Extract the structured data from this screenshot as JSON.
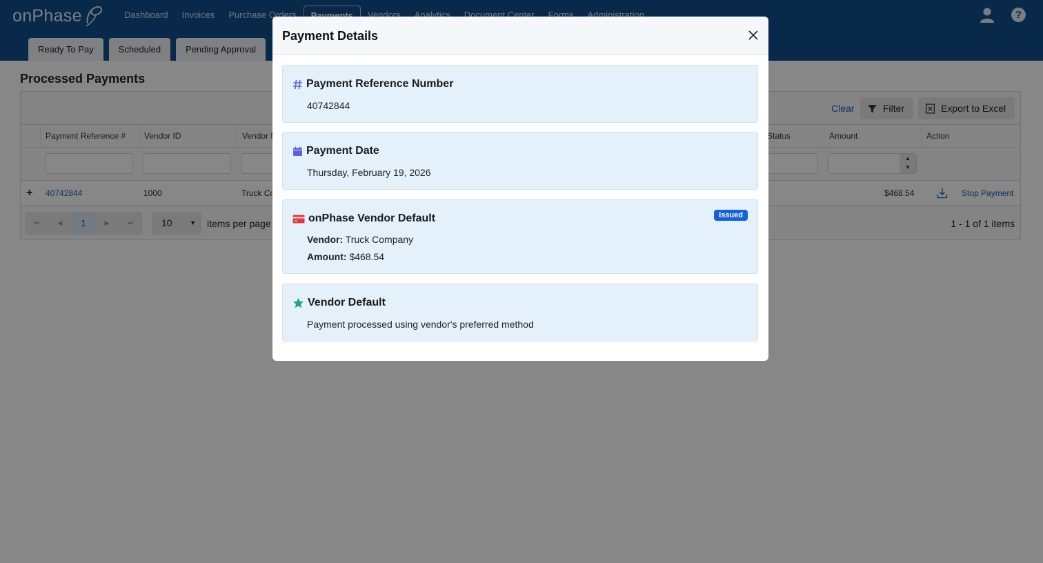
{
  "app": {
    "logo": "onPhase"
  },
  "nav": [
    {
      "label": "Dashboard"
    },
    {
      "label": "Invoices"
    },
    {
      "label": "Purchase Orders"
    },
    {
      "label": "Payments"
    },
    {
      "label": "Vendors"
    },
    {
      "label": "Analytics"
    },
    {
      "label": "Document Center"
    },
    {
      "label": "Forms"
    },
    {
      "label": "Administration"
    }
  ],
  "help": {
    "glyph": "?"
  },
  "subtabs": [
    {
      "label": "Ready To Pay"
    },
    {
      "label": "Scheduled"
    },
    {
      "label": "Pending Approval"
    }
  ],
  "page": {
    "title": "Processed Payments"
  },
  "toolbar": {
    "clear": "Clear",
    "filter": "Filter",
    "export": "Export to Excel"
  },
  "grid": {
    "columns": [
      "Payment Reference #",
      "Vendor ID",
      "Vendor N",
      "Status",
      "Amount",
      "Action"
    ],
    "row": {
      "expand": "+",
      "ref": "40742844",
      "vendor_id": "1000",
      "vendor_name": "Truck Co",
      "amount": "$468.54",
      "action": "Stop Payment"
    }
  },
  "pager": {
    "current": "1",
    "first": "⏮",
    "prev": "◀",
    "next": "▶",
    "last": "⏭",
    "size": "10",
    "caret": "▼",
    "label": "items per page",
    "info": "1 - 1 of 1 items"
  },
  "modal": {
    "title": "Payment Details",
    "reference": {
      "title": "Payment Reference Number",
      "value": "40742844"
    },
    "date": {
      "title": "Payment Date",
      "value": "Thursday, February 19, 2026"
    },
    "method": {
      "title": "onPhase Vendor Default",
      "badge": "Issued",
      "vendor_label": "Vendor:",
      "vendor_value": "Truck Company",
      "amount_label": "Amount:",
      "amount_value": "$468.54"
    },
    "vendor_default": {
      "title": "Vendor Default",
      "value": "Payment processed using vendor's preferred method"
    }
  },
  "colors": {
    "header": "#124f8c",
    "card_bg": "#e4f1fb",
    "badge": "#1560e0",
    "link": "#1f5fb8",
    "hash_icon": "#5a63d6",
    "calendar_icon": "#5a63d6",
    "card_icon": "#e03b3b",
    "star_icon": "#1aa87a"
  }
}
